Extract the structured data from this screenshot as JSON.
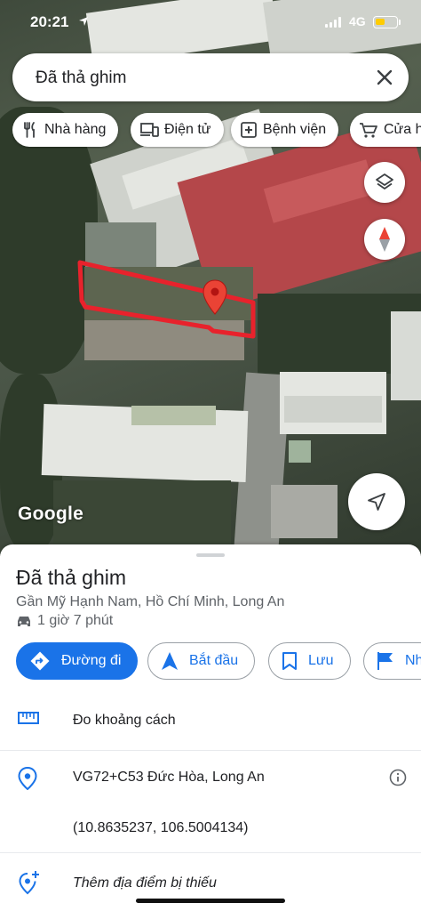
{
  "status_bar": {
    "time": "20:21",
    "network": "4G"
  },
  "search": {
    "query": "Đã thả ghim"
  },
  "chips": [
    {
      "label": "Nhà hàng",
      "icon": "fork-knife-icon"
    },
    {
      "label": "Điện tử",
      "icon": "devices-icon"
    },
    {
      "label": "Bệnh viện",
      "icon": "hospital-icon"
    },
    {
      "label": "Cửa h",
      "icon": "cart-icon"
    }
  ],
  "map": {
    "attribution": "Google",
    "layers_icon": "layers-icon",
    "compass_icon": "compass-icon",
    "location_icon": "navigation-arrow-icon"
  },
  "place": {
    "title": "Đã thả ghim",
    "subtitle": "Gần Mỹ Hạnh Nam, Hồ Chí Minh, Long An",
    "travel_time": "1 giờ 7 phút"
  },
  "actions": [
    {
      "label": "Đường đi",
      "icon": "directions-icon",
      "primary": true
    },
    {
      "label": "Bắt đầu",
      "icon": "navigate-icon",
      "primary": false
    },
    {
      "label": "Lưu",
      "icon": "bookmark-icon",
      "primary": false
    },
    {
      "label": "Nh",
      "icon": "flag-icon",
      "primary": false
    }
  ],
  "details": {
    "measure": "Đo khoảng cách",
    "plus_code": "VG72+C53 Đức Hòa, Long An",
    "coordinates": "(10.8635237, 106.5004134)",
    "add_place": "Thêm địa điểm bị thiếu"
  },
  "colors": {
    "accent": "#1a73e8",
    "pin": "#ea4335",
    "annotation": "#e8222c"
  }
}
